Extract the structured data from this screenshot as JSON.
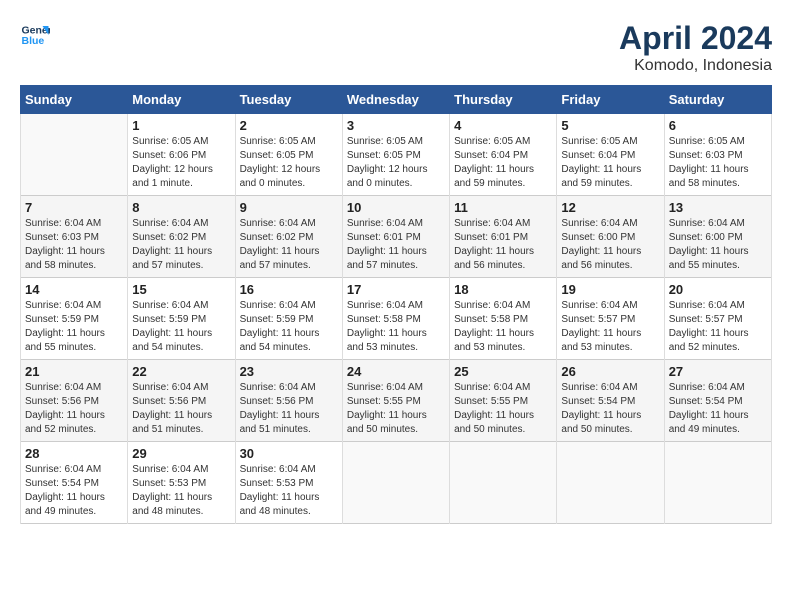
{
  "header": {
    "logo_line1": "General",
    "logo_line2": "Blue",
    "month": "April 2024",
    "location": "Komodo, Indonesia"
  },
  "days_of_week": [
    "Sunday",
    "Monday",
    "Tuesday",
    "Wednesday",
    "Thursday",
    "Friday",
    "Saturday"
  ],
  "weeks": [
    [
      {
        "day": "",
        "info": ""
      },
      {
        "day": "1",
        "info": "Sunrise: 6:05 AM\nSunset: 6:06 PM\nDaylight: 12 hours\nand 1 minute."
      },
      {
        "day": "2",
        "info": "Sunrise: 6:05 AM\nSunset: 6:05 PM\nDaylight: 12 hours\nand 0 minutes."
      },
      {
        "day": "3",
        "info": "Sunrise: 6:05 AM\nSunset: 6:05 PM\nDaylight: 12 hours\nand 0 minutes."
      },
      {
        "day": "4",
        "info": "Sunrise: 6:05 AM\nSunset: 6:04 PM\nDaylight: 11 hours\nand 59 minutes."
      },
      {
        "day": "5",
        "info": "Sunrise: 6:05 AM\nSunset: 6:04 PM\nDaylight: 11 hours\nand 59 minutes."
      },
      {
        "day": "6",
        "info": "Sunrise: 6:05 AM\nSunset: 6:03 PM\nDaylight: 11 hours\nand 58 minutes."
      }
    ],
    [
      {
        "day": "7",
        "info": "Sunrise: 6:04 AM\nSunset: 6:03 PM\nDaylight: 11 hours\nand 58 minutes."
      },
      {
        "day": "8",
        "info": "Sunrise: 6:04 AM\nSunset: 6:02 PM\nDaylight: 11 hours\nand 57 minutes."
      },
      {
        "day": "9",
        "info": "Sunrise: 6:04 AM\nSunset: 6:02 PM\nDaylight: 11 hours\nand 57 minutes."
      },
      {
        "day": "10",
        "info": "Sunrise: 6:04 AM\nSunset: 6:01 PM\nDaylight: 11 hours\nand 57 minutes."
      },
      {
        "day": "11",
        "info": "Sunrise: 6:04 AM\nSunset: 6:01 PM\nDaylight: 11 hours\nand 56 minutes."
      },
      {
        "day": "12",
        "info": "Sunrise: 6:04 AM\nSunset: 6:00 PM\nDaylight: 11 hours\nand 56 minutes."
      },
      {
        "day": "13",
        "info": "Sunrise: 6:04 AM\nSunset: 6:00 PM\nDaylight: 11 hours\nand 55 minutes."
      }
    ],
    [
      {
        "day": "14",
        "info": "Sunrise: 6:04 AM\nSunset: 5:59 PM\nDaylight: 11 hours\nand 55 minutes."
      },
      {
        "day": "15",
        "info": "Sunrise: 6:04 AM\nSunset: 5:59 PM\nDaylight: 11 hours\nand 54 minutes."
      },
      {
        "day": "16",
        "info": "Sunrise: 6:04 AM\nSunset: 5:59 PM\nDaylight: 11 hours\nand 54 minutes."
      },
      {
        "day": "17",
        "info": "Sunrise: 6:04 AM\nSunset: 5:58 PM\nDaylight: 11 hours\nand 53 minutes."
      },
      {
        "day": "18",
        "info": "Sunrise: 6:04 AM\nSunset: 5:58 PM\nDaylight: 11 hours\nand 53 minutes."
      },
      {
        "day": "19",
        "info": "Sunrise: 6:04 AM\nSunset: 5:57 PM\nDaylight: 11 hours\nand 53 minutes."
      },
      {
        "day": "20",
        "info": "Sunrise: 6:04 AM\nSunset: 5:57 PM\nDaylight: 11 hours\nand 52 minutes."
      }
    ],
    [
      {
        "day": "21",
        "info": "Sunrise: 6:04 AM\nSunset: 5:56 PM\nDaylight: 11 hours\nand 52 minutes."
      },
      {
        "day": "22",
        "info": "Sunrise: 6:04 AM\nSunset: 5:56 PM\nDaylight: 11 hours\nand 51 minutes."
      },
      {
        "day": "23",
        "info": "Sunrise: 6:04 AM\nSunset: 5:56 PM\nDaylight: 11 hours\nand 51 minutes."
      },
      {
        "day": "24",
        "info": "Sunrise: 6:04 AM\nSunset: 5:55 PM\nDaylight: 11 hours\nand 50 minutes."
      },
      {
        "day": "25",
        "info": "Sunrise: 6:04 AM\nSunset: 5:55 PM\nDaylight: 11 hours\nand 50 minutes."
      },
      {
        "day": "26",
        "info": "Sunrise: 6:04 AM\nSunset: 5:54 PM\nDaylight: 11 hours\nand 50 minutes."
      },
      {
        "day": "27",
        "info": "Sunrise: 6:04 AM\nSunset: 5:54 PM\nDaylight: 11 hours\nand 49 minutes."
      }
    ],
    [
      {
        "day": "28",
        "info": "Sunrise: 6:04 AM\nSunset: 5:54 PM\nDaylight: 11 hours\nand 49 minutes."
      },
      {
        "day": "29",
        "info": "Sunrise: 6:04 AM\nSunset: 5:53 PM\nDaylight: 11 hours\nand 48 minutes."
      },
      {
        "day": "30",
        "info": "Sunrise: 6:04 AM\nSunset: 5:53 PM\nDaylight: 11 hours\nand 48 minutes."
      },
      {
        "day": "",
        "info": ""
      },
      {
        "day": "",
        "info": ""
      },
      {
        "day": "",
        "info": ""
      },
      {
        "day": "",
        "info": ""
      }
    ]
  ]
}
